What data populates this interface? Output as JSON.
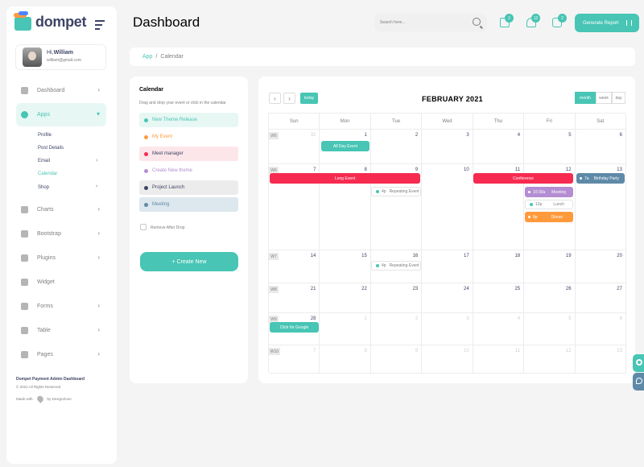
{
  "brand": {
    "name": "dompet"
  },
  "profile": {
    "greeting": "Hi,",
    "name": "William",
    "email": "william@gmail.com"
  },
  "nav": {
    "items": [
      {
        "label": "Dashboard",
        "icon": "dashboard-icon"
      },
      {
        "label": "Apps",
        "icon": "info-icon"
      },
      {
        "label": "Charts",
        "icon": "charts-icon"
      },
      {
        "label": "Bootstrap",
        "icon": "star-icon"
      },
      {
        "label": "Plugins",
        "icon": "heart-icon"
      },
      {
        "label": "Widget",
        "icon": "widget-icon"
      },
      {
        "label": "Forms",
        "icon": "forms-icon"
      },
      {
        "label": "Table",
        "icon": "table-icon"
      },
      {
        "label": "Pages",
        "icon": "pages-icon"
      }
    ],
    "apps_sub": [
      "Profile",
      "Post Details",
      "Email",
      "Calendar",
      "Shop"
    ]
  },
  "footer": {
    "title": "Dompet Payment Admin Dashboard",
    "copyright": "© 2021 All Rights Reserved",
    "made_with": "Made with",
    "by": "by DesignZone"
  },
  "header": {
    "title": "Dashboard",
    "search_placeholder": "Search here...",
    "badges": [
      "2",
      "12",
      "2"
    ],
    "generate_label": "Generate Report"
  },
  "breadcrumb": {
    "parent": "App",
    "sep": "/",
    "current": "Calendar"
  },
  "events_panel": {
    "title": "Calendar",
    "subtitle": "Drag and drop your event or click in the calendar",
    "events": [
      {
        "label": "New Theme Release",
        "color": "#48c5b4",
        "bg": "#e7f7f4",
        "text": "#48c5b4"
      },
      {
        "label": "My Event",
        "color": "#ff9a3c",
        "bg": "#ffffff",
        "text": "#ff9a3c"
      },
      {
        "label": "Meet manager",
        "color": "#f72b50",
        "bg": "#fde6ea",
        "text": "#3d4465"
      },
      {
        "label": "Create New theme",
        "color": "#b48dd3",
        "bg": "#ffffff",
        "text": "#b48dd3"
      },
      {
        "label": "Project Launch",
        "color": "#3d4465",
        "bg": "#ececec",
        "text": "#3d4465"
      },
      {
        "label": "Meeting",
        "color": "#5e8aa8",
        "bg": "#dde7ee",
        "text": "#5e8aa8"
      }
    ],
    "remove_after_drop": "Remove After Drop",
    "create_label": "+ Create New"
  },
  "calendar": {
    "prev": "‹",
    "next": "›",
    "today_label": "today",
    "month_title": "FEBRUARY 2021",
    "views": [
      "month",
      "week",
      "day"
    ],
    "days": [
      "Sun",
      "Mon",
      "Tue",
      "Wed",
      "Thu",
      "Fri",
      "Sat"
    ],
    "weeks": [
      {
        "wk": "W5",
        "dates": [
          "31",
          "1",
          "2",
          "3",
          "4",
          "5",
          "6"
        ],
        "out": [
          true,
          false,
          false,
          false,
          false,
          false,
          false
        ]
      },
      {
        "wk": "W6",
        "dates": [
          "7",
          "8",
          "9",
          "10",
          "11",
          "12",
          "13"
        ],
        "out": [
          false,
          false,
          false,
          false,
          false,
          false,
          false
        ]
      },
      {
        "wk": "W7",
        "dates": [
          "14",
          "15",
          "16",
          "17",
          "18",
          "19",
          "20"
        ],
        "out": [
          false,
          false,
          false,
          false,
          false,
          false,
          false
        ]
      },
      {
        "wk": "W8",
        "dates": [
          "21",
          "22",
          "23",
          "24",
          "25",
          "26",
          "27"
        ],
        "out": [
          false,
          false,
          false,
          false,
          false,
          false,
          false
        ]
      },
      {
        "wk": "W9",
        "dates": [
          "28",
          "1",
          "2",
          "3",
          "4",
          "5",
          "6"
        ],
        "out": [
          false,
          true,
          true,
          true,
          true,
          true,
          true
        ]
      },
      {
        "wk": "W10",
        "dates": [
          "7",
          "8",
          "9",
          "10",
          "11",
          "12",
          "13"
        ],
        "out": [
          true,
          true,
          true,
          true,
          true,
          true,
          true
        ]
      }
    ],
    "events": {
      "all_day": "All Day Event",
      "long_event": "Long Event",
      "conference": "Conference",
      "birthday_time": "7a",
      "birthday": "Birthday Party",
      "repeat_time": "4p",
      "repeat": "Repeating Event",
      "meeting_time": "10:30a",
      "meeting": "Meeting",
      "lunch_time": "12p",
      "lunch": "Lunch",
      "dinner_time": "8p",
      "dinner": "Dinner",
      "google": "Click for Google"
    }
  }
}
